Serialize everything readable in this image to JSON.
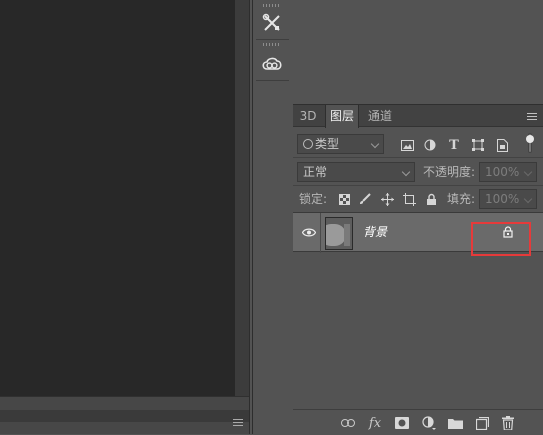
{
  "tabs": [
    "3D",
    "图层",
    "通道"
  ],
  "filter": {
    "kind_label": "类型",
    "icons": [
      "image-filter-icon",
      "adjustment-filter-icon",
      "type-filter-icon",
      "shape-filter-icon",
      "smart-object-filter-icon",
      "filter-toggle-icon"
    ]
  },
  "blend": {
    "mode": "正常",
    "opacity_label": "不透明度:",
    "opacity_value": "100%"
  },
  "lock": {
    "label": "锁定:",
    "icons": [
      "lock-transparent-icon",
      "lock-image-icon",
      "lock-position-icon",
      "lock-artboard-icon",
      "lock-all-icon"
    ],
    "fill_label": "填充:",
    "fill_value": "100%"
  },
  "layers": [
    {
      "name": "背景",
      "visible": true,
      "locked": true
    }
  ],
  "bottom_icons": [
    "link-layers-icon",
    "fx-icon",
    "add-mask-icon",
    "adjustment-layer-icon",
    "new-group-icon",
    "new-layer-icon",
    "delete-layer-icon"
  ],
  "tool_icons": [
    "tools-icon",
    "creative-cloud-icon"
  ],
  "colors": {
    "highlight": "#e63a3a",
    "panel": "#535353",
    "canvas": "#282828"
  }
}
